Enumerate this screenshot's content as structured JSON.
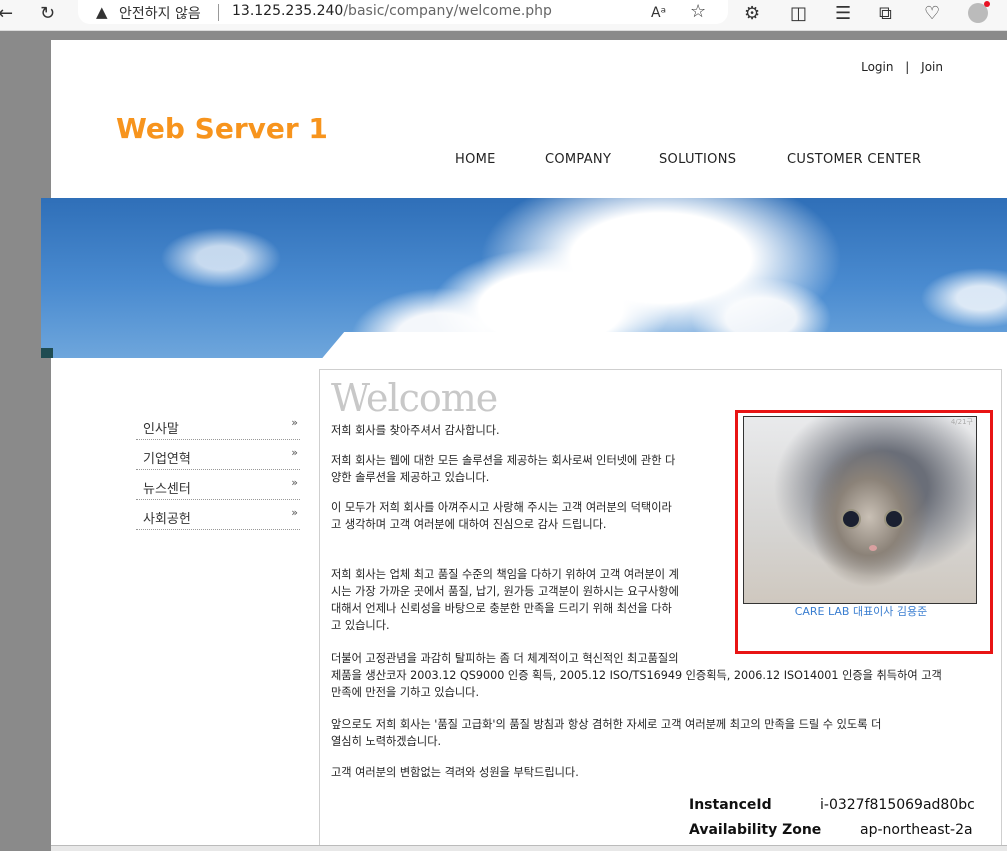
{
  "browser": {
    "security_label": "안전하지 않음",
    "url_host": "13.125.235.240",
    "url_path": "/basic/company/welcome.php"
  },
  "header": {
    "login": "Login",
    "separator": "|",
    "join": "Join",
    "site_title": "Web Server 1",
    "nav": [
      "HOME",
      "COMPANY",
      "SOLUTIONS",
      "CUSTOMER CENTER"
    ]
  },
  "sidebar": {
    "items": [
      {
        "label": "인사말",
        "arrow": "»"
      },
      {
        "label": "기업연혁",
        "arrow": "»"
      },
      {
        "label": "뉴스센터",
        "arrow": "»"
      },
      {
        "label": "사회공헌",
        "arrow": "»"
      }
    ]
  },
  "content": {
    "heading": "Welcome",
    "p1": "저희 회사를 찾아주셔서 감사합니다.",
    "p2a": "저희 회사는 웹에 대한 모든 솔루션을 제공하는 회사로써 인터넷에 관한 다",
    "p2b": "양한 솔루션을 제공하고 있습니다.",
    "p3a": "이 모두가 저희 회사를 아껴주시고 사랑해 주시는 고객 여러분의 덕택이라",
    "p3b": "고 생각하며 고객 여러분에 대하여 진심으로 감사 드립니다.",
    "p4a": "저희 회사는 업체 최고 품질 수준의 책임을 다하기 위하여 고객 여러분이 계",
    "p4b": "시는 가장 가까운 곳에서 품질, 납기, 원가등 고객분이 원하시는 요구사항에",
    "p4c": "대해서 언제나 신뢰성을 바탕으로 충분한 만족을 드리기 위해 최선을 다하",
    "p4d": "고 있습니다.",
    "p5a": "더불어 고정관념을 과감히 탈피하는 좀 더 체계적이고 혁신적인 최고품질의",
    "p5b": "제품을 생산코자 2003.12 QS9000 인증 획득, 2005.12 ISO/TS16949 인증획득, 2006.12 ISO14001 인증을 취득하여 고객",
    "p5c": "만족에 만전을 기하고 있습니다.",
    "p6a": "앞으로도 저희 회사는 '품질 고급화'의 품질 방침과 항상 겸허한 자세로 고객 여러분께 최고의 만족을 드릴 수 있도록 더",
    "p6b": "열심히 노력하겠습니다.",
    "p7": "고객 여러분의 변함없는 격려와 성원을 부탁드립니다.",
    "photo_caption": "CARE LAB 대표이사 김용준",
    "photo_watermark": "4/21구"
  },
  "instance": {
    "id_label": "InstanceId",
    "id_value": "i-0327f815069ad80bc",
    "az_label": "Availability Zone",
    "az_value": "ap-northeast-2a"
  }
}
